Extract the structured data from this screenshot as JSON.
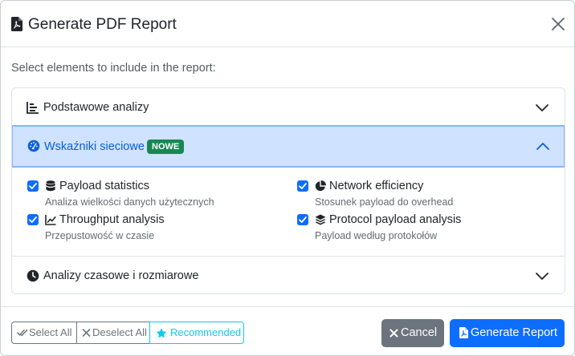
{
  "modal": {
    "title": "Generate PDF Report",
    "intro": "Select elements to include in the report:"
  },
  "sections": [
    {
      "label": "Podstawowe analizy",
      "icon": "chart-bar-icon",
      "expanded": false
    },
    {
      "label": "Wskaźniki sieciowe",
      "icon": "gauge-icon",
      "badge": "NOWE",
      "expanded": true,
      "options": [
        {
          "name": "Payload statistics",
          "description": "Analiza wielkości danych użytecznych",
          "icon": "database-icon",
          "checked": true
        },
        {
          "name": "Network efficiency",
          "description": "Stosunek payload do overhead",
          "icon": "pie-chart-icon",
          "checked": true
        },
        {
          "name": "Throughput analysis",
          "description": "Przepustowość w czasie",
          "icon": "line-chart-icon",
          "checked": true
        },
        {
          "name": "Protocol payload analysis",
          "description": "Payload według protokołów",
          "icon": "layers-icon",
          "checked": true
        }
      ]
    },
    {
      "label": "Analizy czasowe i rozmiarowe",
      "icon": "clock-icon",
      "expanded": false
    }
  ],
  "footer": {
    "select_all": "Select All",
    "deselect_all": "Deselect All",
    "recommended": "Recommended",
    "cancel": "Cancel",
    "generate": "Generate Report"
  },
  "colors": {
    "primary": "#0d6efd",
    "secondary": "#6c757d",
    "info": "#0dcaf0",
    "success": "#198754",
    "active_header_bg": "#cfe2ff"
  }
}
